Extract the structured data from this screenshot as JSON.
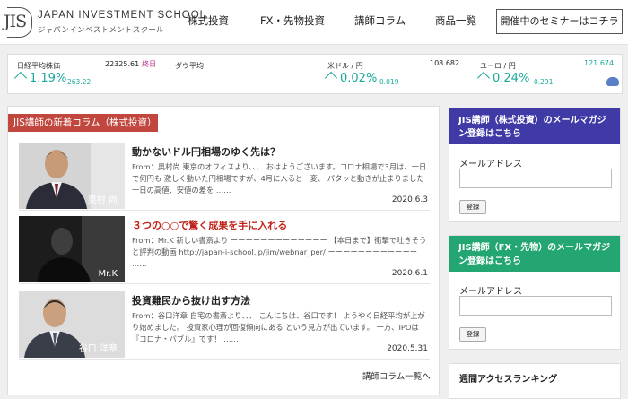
{
  "header": {
    "logo_en": "JAPAN INVESTMENT SCHOOL",
    "logo_ja": "ジャパンインベストメントスクール",
    "logo_mark": "JIS",
    "nav": [
      "株式投資",
      "FX・先物投資",
      "講師コラム",
      "商品一覧"
    ],
    "cta": "開催中のセミナーはコチラ"
  },
  "ticker": [
    {
      "name": "日経平均株価",
      "value": "22325.61",
      "end_label": "終日",
      "pct": "1.19%",
      "change": "263.22"
    },
    {
      "name": "ダウ平均",
      "value": "",
      "end_label": "",
      "pct": "",
      "change": ""
    },
    {
      "name": "米ドル / 円",
      "value": "108.682",
      "end_label": "",
      "pct": "0.02%",
      "change": "0.019"
    },
    {
      "name": "ユーロ / 円",
      "value": "121.674",
      "end_label": "",
      "pct": "0.24%",
      "change": "0.291"
    }
  ],
  "colors": {
    "up": "#1aa99a",
    "accent_red": "#c1473e",
    "purple": "#3f3aa6",
    "green": "#24a673"
  },
  "columns": {
    "heading": "JIS講師の新着コラム（株式投資）",
    "articles": [
      {
        "author": "奥村 尚",
        "title": "動かないドル円相場のゆく先は？",
        "body": "From：奥村尚 東京のオフィスより、、、 おはようございます。コロナ相場で3月は、一日で何円も 激しく動いた円相場ですが、4月に入ると一変、 パタッと動きが止まりました 一日の高値、安値の差を ……",
        "date": "2020.6.3"
      },
      {
        "author": "Mr.K",
        "title": "３つの○○で驚く成果を手に入れる",
        "body": "From：Mr.K 新しい書斎より ーーーーーーーーーーーーー 【本日まで】衝撃で吐きそうと評判の動画 http://japan-i-school.jp/jim/webnar_per/ ーーーーーーーーーーーー ……",
        "date": "2020.6.1"
      },
      {
        "author": "谷口 洋章",
        "title": "投資難民から抜け出す方法",
        "body": "From：谷口洋章 自宅の書斎より、、、 こんにちは、谷口です！ ようやく日経平均が上がり始めました。 投資家心理が回復傾向にある という見方が出ています。 一方、IPOは『コロナ・バブル』です！ ……",
        "date": "2020.5.31"
      }
    ],
    "more_link": "講師コラム一覧へ"
  },
  "sidebar": {
    "magazines": [
      {
        "title": "JIS講師（株式投資）のメールマガジン登録はこちら",
        "email_label": "メールアドレス",
        "button": "登録"
      },
      {
        "title": "JIS講師（FX・先物）のメールマガジン登録はこちら",
        "email_label": "メールアドレス",
        "button": "登録"
      }
    ],
    "ranking_title": "週間アクセスランキング"
  }
}
